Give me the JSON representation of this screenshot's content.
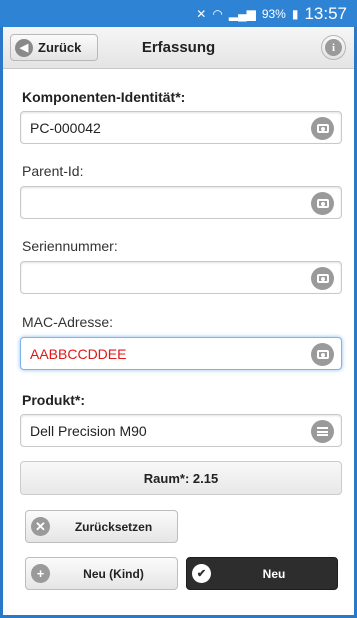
{
  "status_bar": {
    "battery": "93%",
    "time": "13:57"
  },
  "header": {
    "back_label": "Zurück",
    "title": "Erfassung"
  },
  "form": {
    "komponenten_label": "Komponenten-Identität*:",
    "komponenten_value": "PC-000042",
    "parent_label": "Parent-Id:",
    "parent_value": "",
    "serien_label": "Seriennummer:",
    "serien_value": "",
    "mac_label": "MAC-Adresse:",
    "mac_value": "AABBCCDDEE",
    "produkt_label": "Produkt*:",
    "produkt_value": "Dell Precision M90"
  },
  "raum_label": "Raum*: 2.15",
  "buttons": {
    "reset_label": "Zurücksetzen",
    "new_child_label": "Neu (Kind)",
    "new_label": "Neu"
  },
  "colors": {
    "accent": "#2e83d4",
    "error_text": "#e01818",
    "dark_button": "#2d2d2d"
  }
}
